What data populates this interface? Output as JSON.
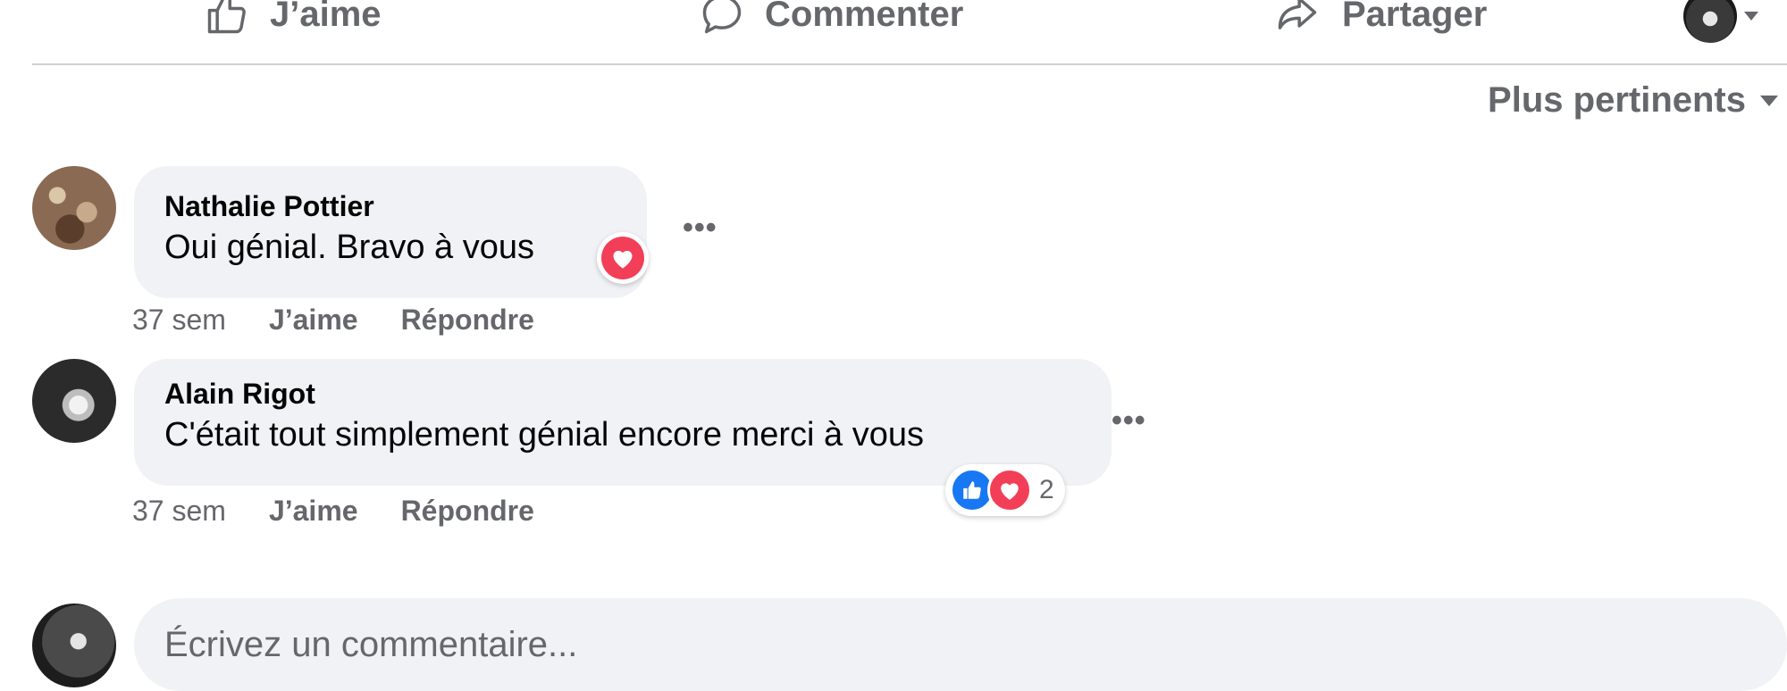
{
  "actions": {
    "like_label": "J’aime",
    "comment_label": "Commenter",
    "share_label": "Partager"
  },
  "sort": {
    "label": "Plus pertinents"
  },
  "comments": [
    {
      "author": "Nathalie Pottier",
      "text": "Oui génial. Bravo à vous",
      "time": "37 sem",
      "like_label": "J’aime",
      "reply_label": "Répondre",
      "reactions": [
        "love"
      ]
    },
    {
      "author": "Alain Rigot",
      "text": "C'était tout simplement génial encore merci à vous",
      "time": "37 sem",
      "like_label": "J’aime",
      "reply_label": "Répondre",
      "reactions": [
        "like",
        "love"
      ],
      "reaction_count": "2"
    }
  ],
  "composer": {
    "placeholder": "Écrivez un commentaire..."
  },
  "colors": {
    "secondary_text": "#65676b",
    "bubble_bg": "#f0f2f5",
    "like_blue": "#1877f2",
    "love_red": "#f33e58"
  }
}
